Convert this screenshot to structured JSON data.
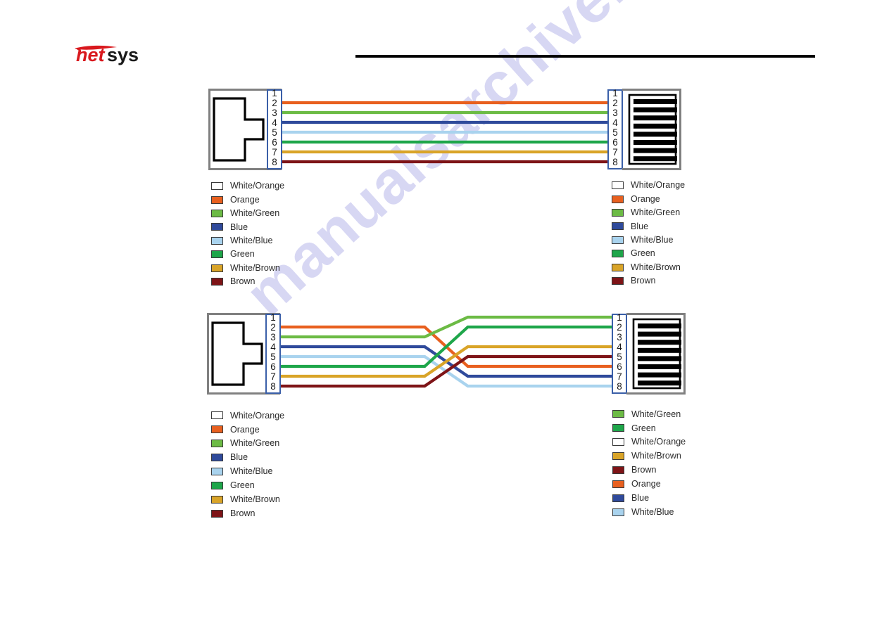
{
  "brand": {
    "name_part1": "net",
    "name_part2": "sys",
    "color_red": "#d9191e",
    "color_black": "#1a1a1a"
  },
  "wire_colors": {
    "White/Orange": "#edа22e",
    "Orange": "#e8601f",
    "White/Green": "#6cbb45",
    "Blue": "#2f4a9b",
    "White/Blue": "#a9d3ee",
    "Green": "#1ea64a",
    "White/Brown": "#d9a428",
    "Brown": "#7e1417"
  },
  "watermark": {
    "text": "manualsarchive.com"
  },
  "diagrams": [
    {
      "id": "straight-through",
      "pin_numbers": [
        "1",
        "2",
        "3",
        "4",
        "5",
        "6",
        "7",
        "8"
      ],
      "left_connector": "rj45-plug",
      "right_connector": "rj45-jack",
      "wiring": [
        {
          "from": 1,
          "to": 1,
          "color": "White/Orange"
        },
        {
          "from": 2,
          "to": 2,
          "color": "Orange"
        },
        {
          "from": 3,
          "to": 3,
          "color": "White/Green"
        },
        {
          "from": 4,
          "to": 4,
          "color": "Blue"
        },
        {
          "from": 5,
          "to": 5,
          "color": "White/Blue"
        },
        {
          "from": 6,
          "to": 6,
          "color": "Green"
        },
        {
          "from": 7,
          "to": 7,
          "color": "White/Brown"
        },
        {
          "from": 8,
          "to": 8,
          "color": "Brown"
        }
      ],
      "left_legend": [
        "White/Orange",
        "Orange",
        "White/Green",
        "Blue",
        "White/Blue",
        "Green",
        "White/Brown",
        "Brown"
      ],
      "right_legend": [
        "White/Orange",
        "Orange",
        "White/Green",
        "Blue",
        "White/Blue",
        "Green",
        "White/Brown",
        "Brown"
      ]
    },
    {
      "id": "crossover",
      "pin_numbers": [
        "1",
        "2",
        "3",
        "4",
        "5",
        "6",
        "7",
        "8"
      ],
      "left_connector": "rj45-plug",
      "right_connector": "rj45-jack",
      "wiring": [
        {
          "from": 1,
          "to": 3,
          "color": "White/Orange"
        },
        {
          "from": 2,
          "to": 6,
          "color": "Orange"
        },
        {
          "from": 3,
          "to": 1,
          "color": "White/Green"
        },
        {
          "from": 4,
          "to": 7,
          "color": "Blue"
        },
        {
          "from": 5,
          "to": 8,
          "color": "White/Blue"
        },
        {
          "from": 6,
          "to": 2,
          "color": "Green"
        },
        {
          "from": 7,
          "to": 4,
          "color": "White/Brown"
        },
        {
          "from": 8,
          "to": 5,
          "color": "Brown"
        }
      ],
      "left_legend": [
        "White/Orange",
        "Orange",
        "White/Green",
        "Blue",
        "White/Blue",
        "Green",
        "White/Brown",
        "Brown"
      ],
      "right_legend": [
        "White/Green",
        "Green",
        "White/Orange",
        "White/Brown",
        "Brown",
        "Orange",
        "Blue",
        "White/Blue"
      ]
    }
  ]
}
